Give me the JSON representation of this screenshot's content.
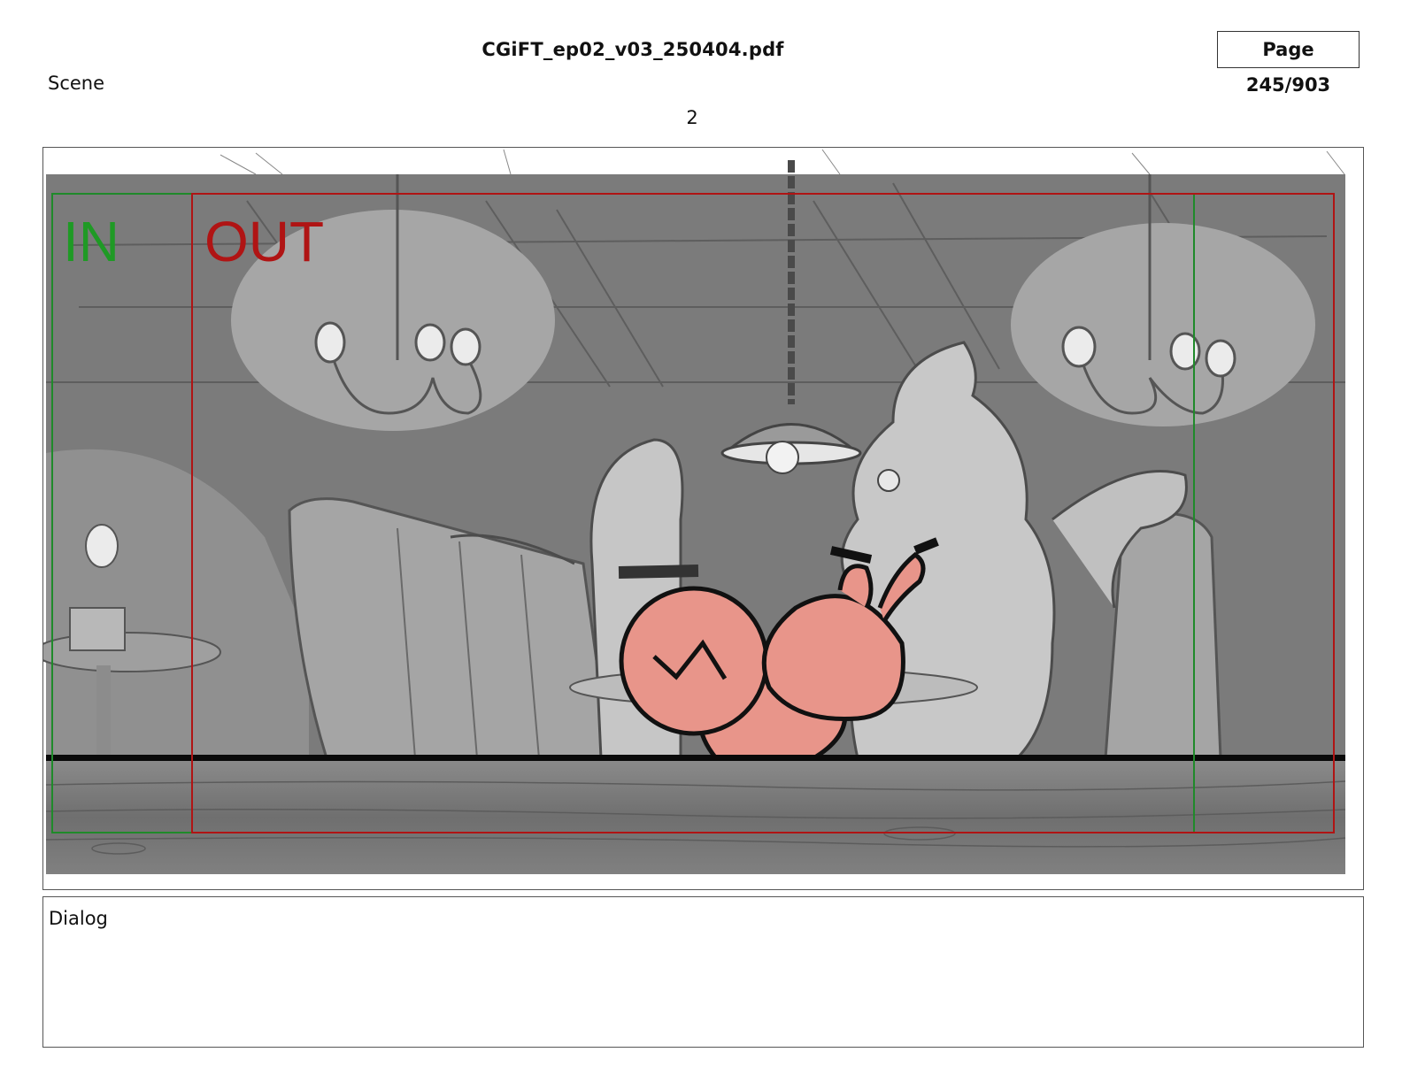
{
  "header": {
    "file_name": "CGiFT_ep02_v03_250404.pdf",
    "page_indicator": "Page 245/903"
  },
  "scene": {
    "label": "Scene",
    "number": "2"
  },
  "panel": {
    "in_label": "IN",
    "out_label": "OUT",
    "colors": {
      "in_frame": "#1f8a2a",
      "out_frame": "#b01414",
      "character_fill": "#e8958a",
      "background_gray": "#7a7a7a"
    }
  },
  "dialog": {
    "label": "Dialog",
    "text": ""
  }
}
